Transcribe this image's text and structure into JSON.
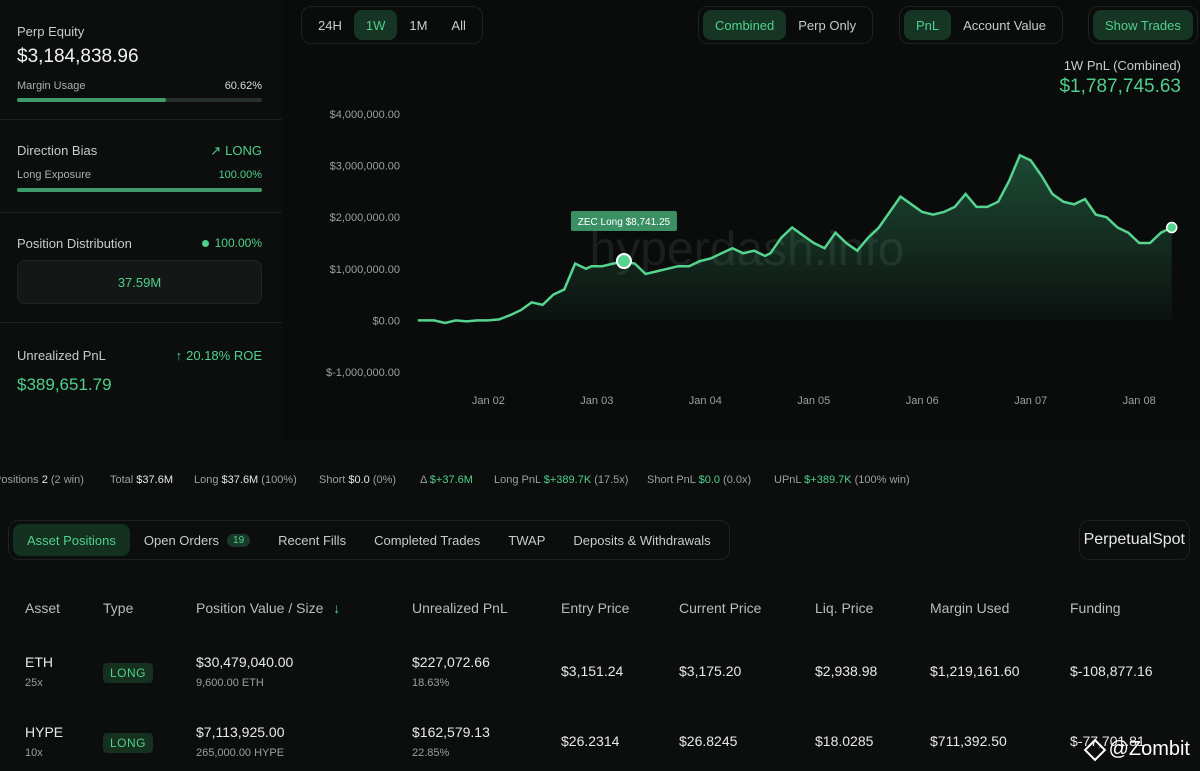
{
  "equity": {
    "label": "Perp Equity",
    "value": "$3,184,838.96",
    "margin_label": "Margin Usage",
    "margin_value": "60.62%",
    "margin_pct": 60.62
  },
  "bias": {
    "label": "Direction Bias",
    "value": "LONG",
    "exposure_label": "Long Exposure",
    "exposure_value": "100.00%",
    "exposure_pct": 100
  },
  "distribution": {
    "label": "Position Distribution",
    "value": "100.00%",
    "amount": "37.59M"
  },
  "upnl": {
    "label": "Unrealized PnL",
    "roe": "20.18% ROE",
    "value": "$389,651.79"
  },
  "timeframes": [
    "24H",
    "1W",
    "1M",
    "All"
  ],
  "timeframe_active": "1W",
  "scope": [
    "Combined",
    "Perp Only"
  ],
  "metric": [
    "PnL",
    "Account Value"
  ],
  "show_trades": "Show Trades",
  "pnl_summary": {
    "label": "1W PnL (Combined)",
    "value": "$1,787,745.63"
  },
  "chart_watermark": "hyperdash.info",
  "tooltip": "ZEC Long $8,741.25",
  "chart_data": {
    "type": "area",
    "ylim": [
      -1000000,
      4000000
    ],
    "yticks": [
      4000000,
      3000000,
      2000000,
      1000000,
      0,
      -1000000
    ],
    "ytick_labels": [
      "$4,000,000.00",
      "$3,000,000.00",
      "$2,000,000.00",
      "$1,000,000.00",
      "$0.00",
      "$-1,000,000.00"
    ],
    "xtick_labels": [
      "Jan 02",
      "Jan 03",
      "Jan 04",
      "Jan 05",
      "Jan 06",
      "Jan 07",
      "Jan 08"
    ],
    "x": [
      1.35,
      1.5,
      1.6,
      1.7,
      1.8,
      1.9,
      2.0,
      2.1,
      2.2,
      2.3,
      2.4,
      2.5,
      2.6,
      2.7,
      2.8,
      2.9,
      2.95,
      3.05,
      3.15,
      3.25,
      3.35,
      3.45,
      3.55,
      3.65,
      3.75,
      3.85,
      3.95,
      4.05,
      4.15,
      4.25,
      4.35,
      4.45,
      4.55,
      4.6,
      4.7,
      4.8,
      4.9,
      5.0,
      5.1,
      5.2,
      5.3,
      5.4,
      5.5,
      5.6,
      5.7,
      5.8,
      5.9,
      6.0,
      6.1,
      6.2,
      6.3,
      6.4,
      6.5,
      6.6,
      6.7,
      6.8,
      6.9,
      7.0,
      7.1,
      7.2,
      7.3,
      7.4,
      7.5,
      7.6,
      7.7,
      7.8,
      7.9,
      8.0,
      8.1,
      8.2,
      8.3
    ],
    "y": [
      0,
      0,
      -50000,
      0,
      -20000,
      0,
      0,
      20000,
      100000,
      200000,
      350000,
      300000,
      500000,
      600000,
      1100000,
      1000000,
      1050000,
      1050000,
      1100000,
      1150000,
      1100000,
      900000,
      950000,
      1000000,
      1050000,
      1050000,
      1150000,
      1200000,
      1300000,
      1400000,
      1300000,
      1350000,
      1250000,
      1300000,
      1600000,
      1800000,
      1650000,
      1500000,
      1400000,
      1700000,
      1500000,
      1350000,
      1600000,
      1800000,
      2100000,
      2400000,
      2250000,
      2100000,
      2050000,
      2100000,
      2200000,
      2450000,
      2200000,
      2200000,
      2300000,
      2700000,
      3200000,
      3100000,
      2800000,
      2450000,
      2300000,
      2250000,
      2350000,
      2050000,
      2000000,
      1800000,
      1700000,
      1500000,
      1500000,
      1700000,
      1800000
    ],
    "highlight_index": 19
  },
  "stats": [
    {
      "label": "Positions",
      "value": "2",
      "extra": "(2 win)"
    },
    {
      "label": "Total",
      "value": "$37.6M",
      "extra": ""
    },
    {
      "label": "Long",
      "value": "$37.6M",
      "extra": "(100%)"
    },
    {
      "label": "Short",
      "value": "$0.0",
      "extra": "(0%)"
    },
    {
      "label": "Δ",
      "value": "$+37.6M",
      "extra": ""
    },
    {
      "label": "Long PnL",
      "value": "$+389.7K",
      "extra": "(17.5x)"
    },
    {
      "label": "Short PnL",
      "value": "$0.0",
      "extra": "(0.0x)"
    },
    {
      "label": "UPnL",
      "value": "$+389.7K",
      "extra": "(100% win)"
    }
  ],
  "tabs": [
    {
      "label": "Asset Positions",
      "badge": ""
    },
    {
      "label": "Open Orders",
      "badge": "19"
    },
    {
      "label": "Recent Fills",
      "badge": ""
    },
    {
      "label": "Completed Trades",
      "badge": ""
    },
    {
      "label": "TWAP",
      "badge": ""
    },
    {
      "label": "Deposits & Withdrawals",
      "badge": ""
    }
  ],
  "market": [
    "Perpetual",
    "Spot"
  ],
  "table": {
    "headers": [
      "Asset",
      "Type",
      "Position Value / Size",
      "Unrealized PnL",
      "Entry Price",
      "Current Price",
      "Liq. Price",
      "Margin Used",
      "Funding"
    ],
    "sort_icon": "↓",
    "rows": [
      {
        "asset": "ETH",
        "leverage": "25x",
        "type": "LONG",
        "value": "$30,479,040.00",
        "size": "9,600.00 ETH",
        "pnl": "$227,072.66",
        "pnl_pct": "18.63%",
        "entry": "$3,151.24",
        "current": "$3,175.20",
        "liq": "$2,938.98",
        "margin": "$1,219,161.60",
        "funding": "$-108,877.16"
      },
      {
        "asset": "HYPE",
        "leverage": "10x",
        "type": "LONG",
        "value": "$7,113,925.00",
        "size": "265,000.00 HYPE",
        "pnl": "$162,579.13",
        "pnl_pct": "22.85%",
        "entry": "$26.2314",
        "current": "$26.8245",
        "liq": "$18.0285",
        "margin": "$711,392.50",
        "funding": "$-77,701.81"
      }
    ]
  },
  "watermark": "@Zombit"
}
